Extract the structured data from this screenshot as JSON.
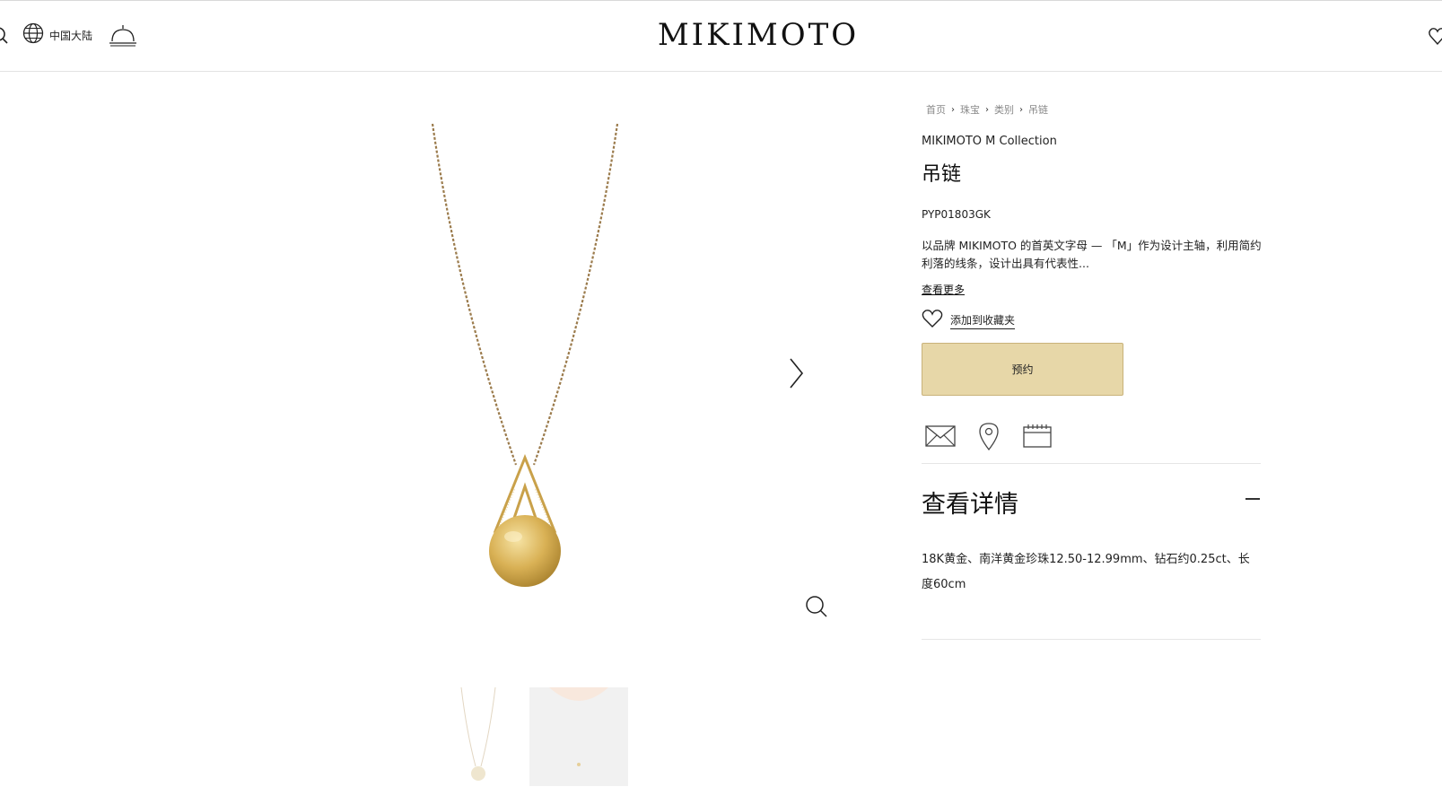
{
  "header": {
    "logo": "MIKIMOTO",
    "region_label": "中国大陆",
    "icons": [
      "search-icon",
      "globe-icon",
      "concierge-bell-icon",
      "heart-icon"
    ]
  },
  "breadcrumb": [
    "首页",
    "珠宝",
    "类别",
    "吊链"
  ],
  "product": {
    "collection": "MIKIMOTO M Collection",
    "title": "吊链",
    "sku": "PYP01803GK",
    "description": "以品牌 MIKIMOTO 的首英文字母 — 「M」作为设计主轴，利用简约利落的线条，设计出具有代表性...",
    "read_more": "查看更多",
    "add_to_wishlist": "添加到收藏夹",
    "reserve_button": "预约"
  },
  "actions": [
    "mail-icon",
    "location-pin-icon",
    "calendar-icon"
  ],
  "details": {
    "heading": "查看详情",
    "toggle_icon": "minus-icon",
    "text": "18K黄金、南洋黄金珍珠12.50-12.99mm、钻石约0.25ct、长度60cm"
  },
  "colors": {
    "reserve_button_bg": "#e7d7a8",
    "gold": "#c9a14a"
  }
}
